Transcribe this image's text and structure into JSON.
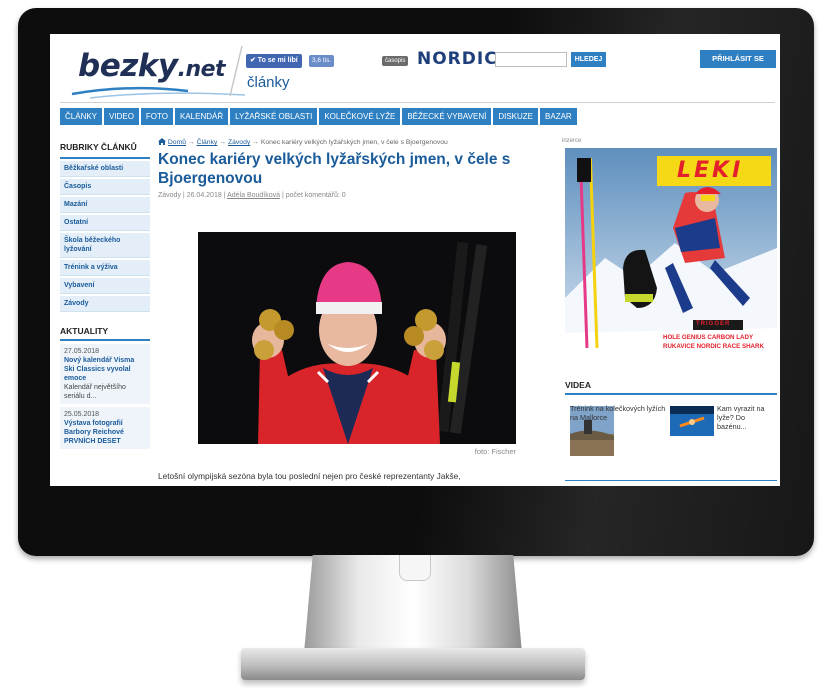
{
  "header": {
    "logo_main": "bezky",
    "logo_suffix": ".net",
    "like_button": "✔ To se mi líbí",
    "like_count": "3,6 tis.",
    "section_title": "články",
    "casopis_badge": "časopis",
    "nordic_label": "NORDIC",
    "search_placeholder": "",
    "search_button": "HLEDEJ",
    "login_button": "PŘIHLÁSIT SE"
  },
  "nav": {
    "items": [
      "ČLÁNKY",
      "VIDEO",
      "FOTO",
      "KALENDÁŘ",
      "LYŽAŘSKÉ OBLASTI",
      "KOLEČKOVÉ LYŽE",
      "BĚŽECKÉ VYBAVENÍ",
      "DISKUZE",
      "BAZAR"
    ]
  },
  "left": {
    "rubriky_heading": "RUBRIKY ČLÁNKŮ",
    "rubriky": [
      "Běžkařské oblasti",
      "Časopis",
      "Mazání",
      "Ostatní",
      "Škola běžeckého lyžování",
      "Trénink a výživa",
      "Vybavení",
      "Závody"
    ],
    "aktuality_heading": "AKTUALITY",
    "aktuality": [
      {
        "date": "27.05.2018",
        "title": "Nový kalendář Visma Ski Classics vyvolal emoce",
        "text": "Kalendář největšího seriálu d..."
      },
      {
        "date": "25.05.2018",
        "title": "Výstava fotografií Barbory Reichové PRVNÍCH DESET",
        "text": ""
      }
    ]
  },
  "article": {
    "breadcrumb": {
      "home": "Domů",
      "sep": "→",
      "clanky": "Články",
      "zavody": "Závody",
      "current": "Konec kariéry velkých lyžařských jmen, v čele s Bjoergenovou"
    },
    "title": "Konec kariéry velkých lyžařských jmen, v čele s Bjoergenovou",
    "meta": {
      "category": "Závody",
      "date": "26.04.2018",
      "author": "Adéla Boudíková",
      "comments": "počet komentářů: 0",
      "sep": "|"
    },
    "photo_caption": "foto: Fischer",
    "intro": "Letošní olympijská sezóna byla tou poslední nejen pro české reprezentanty Jakše,"
  },
  "right": {
    "ad_label": "inzerce",
    "ad": {
      "brand": "LEKI",
      "line1": "HOLE GENIUS CARBON LADY",
      "line2": "RUKAVICE NORDIC RACE SHARK",
      "badge": "TRIGGER"
    },
    "videa_heading": "VIDEA",
    "videos": [
      {
        "title": "Trénink na kolečkových lyžích na Mallorce"
      },
      {
        "title": "Kam vyrazit na lyže? Do bazénu..."
      }
    ]
  },
  "colors": {
    "accent": "#2e80c3",
    "link": "#1a5b9a",
    "logo": "#1f2f55",
    "leki_red": "#e3202b",
    "leki_yellow": "#f6d916"
  }
}
